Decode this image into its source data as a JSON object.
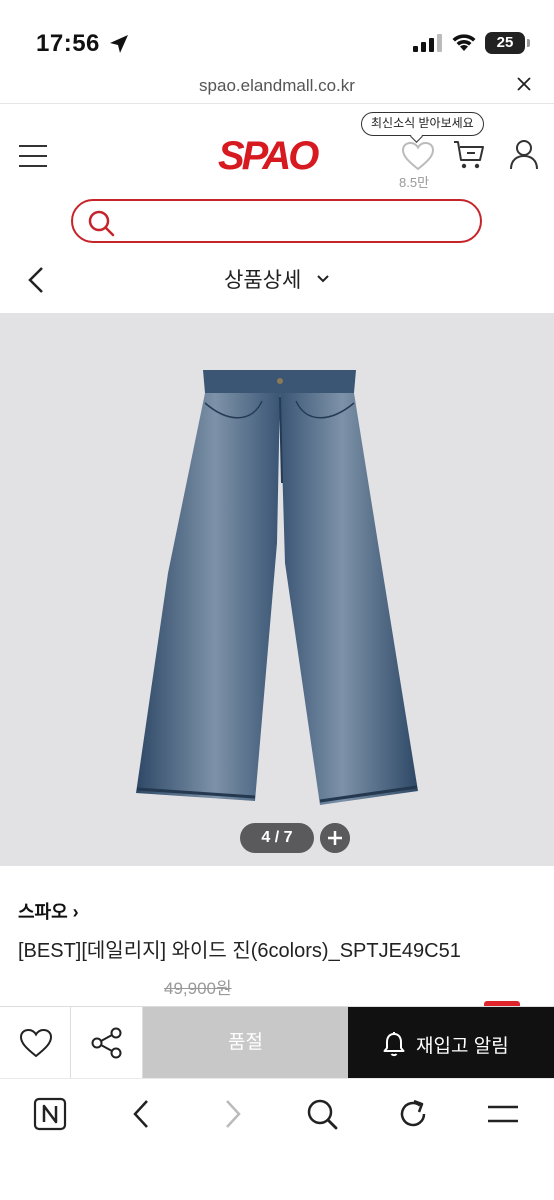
{
  "status_bar": {
    "time": "17:56",
    "battery": "25"
  },
  "browser": {
    "url": "spao.elandmall.co.kr"
  },
  "header": {
    "logo": "SPAO",
    "news_tooltip": "최신소식 받아보세요",
    "wish_count": "8.5만"
  },
  "search": {
    "placeholder": "",
    "value": ""
  },
  "subnav": {
    "title": "상품상세"
  },
  "gallery": {
    "counter": "4 / 7",
    "current": 4,
    "total": 7
  },
  "product": {
    "brand": "스파오 ›",
    "name": "[BEST][데일리지] 와이드 진(6colors)_SPTJE49C51",
    "original_price": "49,900원"
  },
  "actions": {
    "soldout_label": "품절",
    "restock_label": "재입고 알림"
  },
  "colors": {
    "brand_red": "#d71920",
    "search_border": "#c5242b",
    "soldout_bg": "#c8c8c8",
    "restock_bg": "#111111"
  },
  "icons": [
    "location-arrow-icon",
    "signal-icon",
    "wifi-icon",
    "close-icon",
    "menu-icon",
    "heart-icon",
    "cart-icon",
    "user-icon",
    "search-icon",
    "back-icon",
    "chevron-down-icon",
    "plus-icon",
    "share-icon",
    "bell-icon",
    "naver-home-icon",
    "browser-back-icon",
    "browser-forward-icon",
    "browser-search-icon",
    "refresh-icon",
    "browser-menu-icon"
  ]
}
